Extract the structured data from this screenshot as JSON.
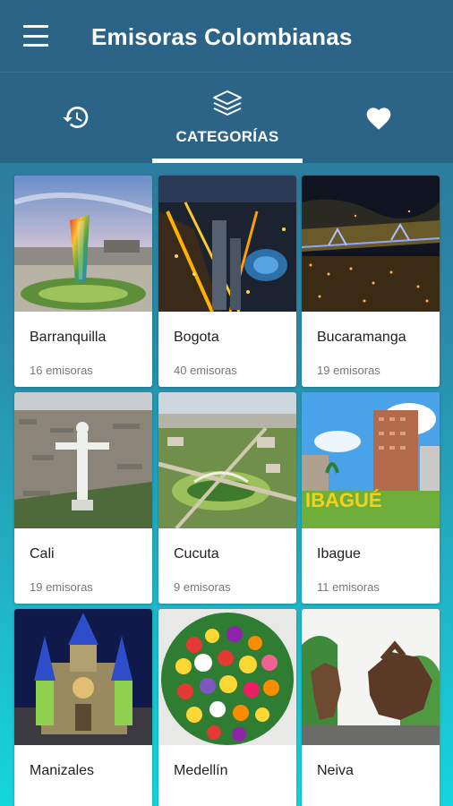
{
  "app": {
    "title": "Emisoras Colombianas"
  },
  "tabs": [
    {
      "icon": "history-icon",
      "label": ""
    },
    {
      "icon": "layers-icon",
      "label": "CATEGORÍAS"
    },
    {
      "icon": "heart-icon",
      "label": ""
    }
  ],
  "cities": [
    {
      "name": "Barranquilla",
      "count": "16 emisoras"
    },
    {
      "name": "Bogota",
      "count": "40 emisoras"
    },
    {
      "name": "Bucaramanga",
      "count": "19 emisoras"
    },
    {
      "name": "Cali",
      "count": "19 emisoras"
    },
    {
      "name": "Cucuta",
      "count": "9 emisoras"
    },
    {
      "name": "Ibague",
      "count": "11 emisoras"
    },
    {
      "name": "Manizales",
      "count": ""
    },
    {
      "name": "Medellín",
      "count": ""
    },
    {
      "name": "Neiva",
      "count": ""
    }
  ],
  "ibague_sign_text": "IBAGUÉ",
  "colors": {
    "appbar": "#2c6487",
    "accent": "#ffffff"
  }
}
